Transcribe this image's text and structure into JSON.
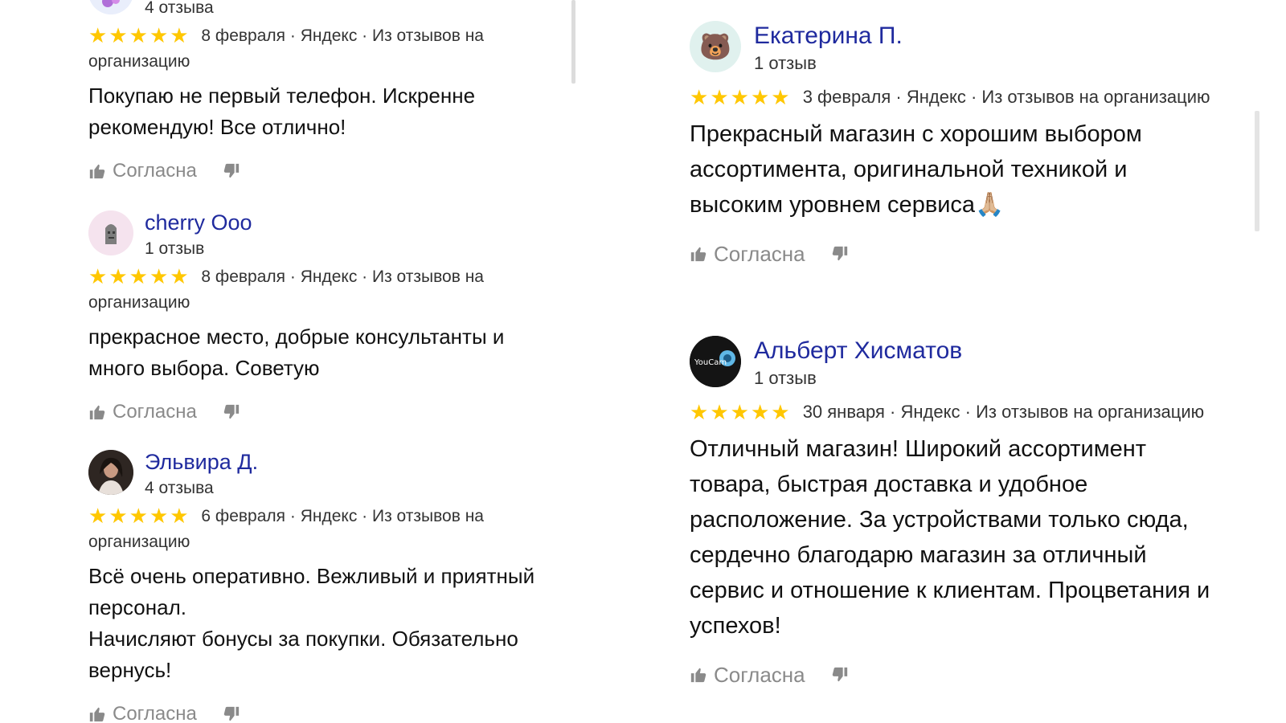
{
  "reviews_left": [
    {
      "author_count": "4 отзыва",
      "rating": 5,
      "date": "8 февраля",
      "source": "Яндекс",
      "origin": "Из отзывов на организацию",
      "text": "Покупаю не первый телефон. Искренне рекомендую! Все отлично!",
      "agree_label": "Согласна"
    },
    {
      "author_name": "cherry Ooo",
      "author_count": "1 отзыв",
      "rating": 5,
      "date": "8 февраля",
      "source": "Яндекс",
      "origin": "Из отзывов на организацию",
      "text": "прекрасное место, добрые консультанты и много выбора. Советую",
      "agree_label": "Согласна"
    },
    {
      "author_name": "Эльвира Д.",
      "author_count": "4 отзыва",
      "rating": 5,
      "date": "6 февраля",
      "source": "Яндекс",
      "origin": "Из отзывов на организацию",
      "text": "Всё очень оперативно. Вежливый и приятный персонал.\nНачисляют бонусы за покупки. Обязательно вернусь!",
      "agree_label": "Согласна"
    }
  ],
  "reviews_right": [
    {
      "author_name": "Екатерина П.",
      "author_count": "1 отзыв",
      "avatar_emoji": "🐻",
      "rating": 5,
      "date": "3 февраля",
      "source": "Яндекс",
      "origin": "Из отзывов на организацию",
      "text": "Прекрасный магазин с хорошим выбором ассортимента, оригинальной техникой и высоким уровнем сервиса🙏🏼",
      "agree_label": "Согласна"
    },
    {
      "author_name": "Альберт Хисматов",
      "author_count": "1 отзыв",
      "avatar_text": "YouCam",
      "rating": 5,
      "date": "30 января",
      "source": "Яндекс",
      "origin": "Из отзывов на организацию",
      "text": "Отличный магазин! Широкий ассортимент товара, быстрая доставка и удобное расположение. За устройствами только сюда, сердечно благодарю магазин за отличный сервис и отношение к клиентам. Процветания и успехов!",
      "agree_label": "Согласна"
    }
  ],
  "colors": {
    "star": "#ffc700",
    "author_name": "#1f2a9e",
    "muted": "#8a8a8a"
  }
}
